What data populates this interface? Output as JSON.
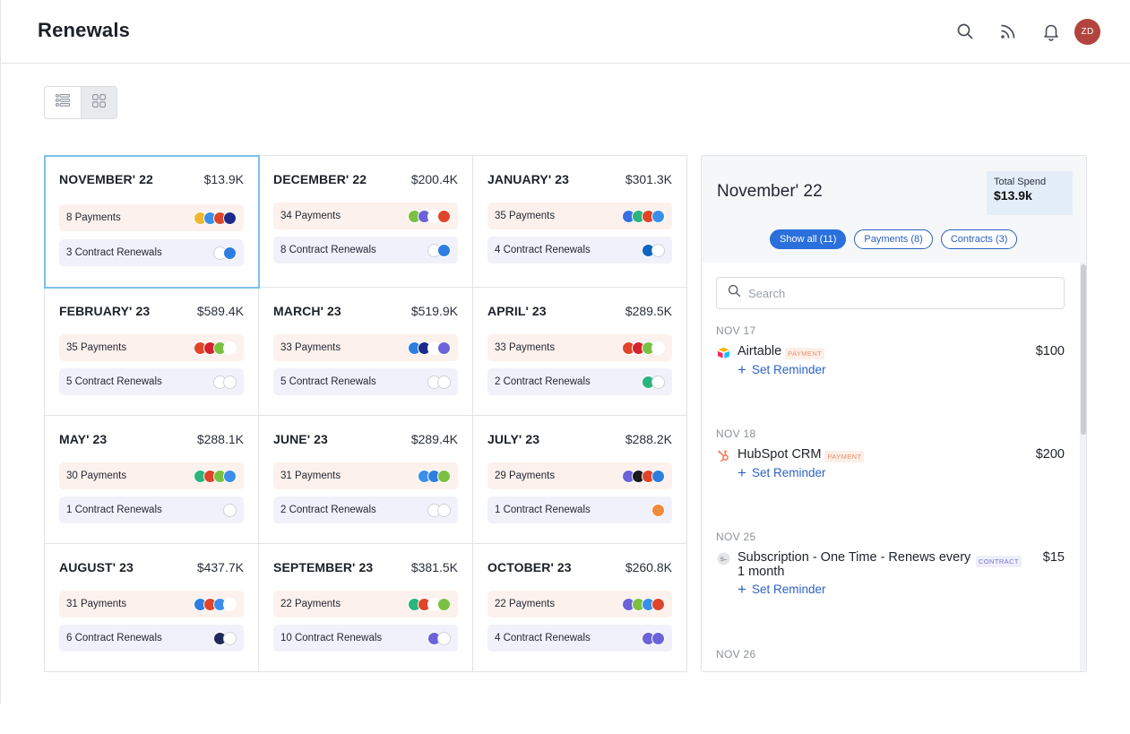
{
  "header": {
    "title": "Renewals",
    "avatar_initials": "ZD",
    "icons": [
      "search-icon",
      "rss-feed-icon",
      "bell-icon"
    ]
  },
  "view_toggle": {
    "options": [
      "list-view-icon",
      "grid-view-icon"
    ],
    "active": "grid"
  },
  "months": [
    {
      "month": "NOVEMBER' 22",
      "amount": "$13.9K",
      "payments": "8 Payments",
      "contracts": "3 Contract Renewals",
      "selected": true,
      "pay_logos": [
        "#f2b731",
        "#3b8fe8",
        "#e0452a",
        "#1e2a8a"
      ],
      "con_logos": [
        "ring",
        "#2f7de1"
      ]
    },
    {
      "month": "DECEMBER' 22",
      "amount": "$200.4K",
      "payments": "34 Payments",
      "contracts": "8 Contract Renewals",
      "pay_logos": [
        "#7ac142",
        "#6c63d8",
        "#ffffff",
        "#e0452a"
      ],
      "con_logos": [
        "ring",
        "#2f7de1"
      ]
    },
    {
      "month": "JANUARY' 23",
      "amount": "$301.3K",
      "payments": "35 Payments",
      "contracts": "4 Contract Renewals",
      "pay_logos": [
        "#3b6fe0",
        "#29b57c",
        "#e0452a",
        "#3b8fe8"
      ],
      "con_logos": [
        "#0a66c2",
        "ring"
      ]
    },
    {
      "month": "FEBRUARY' 23",
      "amount": "$589.4K",
      "payments": "35 Payments",
      "contracts": "5 Contract Renewals",
      "pay_logos": [
        "#e0452a",
        "#d4232f",
        "#7ac142",
        "#ffffff"
      ],
      "con_logos": [
        "ring",
        "ring"
      ]
    },
    {
      "month": "MARCH' 23",
      "amount": "$519.9K",
      "payments": "33 Payments",
      "contracts": "5 Contract Renewals",
      "pay_logos": [
        "#2f7de1",
        "#1e2a8a",
        "#ffffff",
        "#6c63d8"
      ],
      "con_logos": [
        "ring",
        "ring"
      ]
    },
    {
      "month": "APRIL' 23",
      "amount": "$289.5K",
      "payments": "33 Payments",
      "contracts": "2 Contract Renewals",
      "pay_logos": [
        "#e0452a",
        "#d4232f",
        "#7ac142",
        "#ffffff"
      ],
      "con_logos": [
        "#29b57c",
        "ring"
      ]
    },
    {
      "month": "MAY' 23",
      "amount": "$288.1K",
      "payments": "30 Payments",
      "contracts": "1 Contract Renewals",
      "pay_logos": [
        "#29b57c",
        "#e0452a",
        "#7ac142",
        "#3b8fe8"
      ],
      "con_logos": [
        "ring"
      ]
    },
    {
      "month": "JUNE' 23",
      "amount": "$289.4K",
      "payments": "31 Payments",
      "contracts": "2 Contract Renewals",
      "pay_logos": [
        "#3b8fe8",
        "#2f7de1",
        "#7ac142"
      ],
      "con_logos": [
        "ring",
        "ring"
      ]
    },
    {
      "month": "JULY' 23",
      "amount": "$288.2K",
      "payments": "29 Payments",
      "contracts": "1 Contract Renewals",
      "pay_logos": [
        "#6c63d8",
        "#1c1c1c",
        "#e0452a",
        "#2f7de1"
      ],
      "con_logos": [
        "#f08a3c"
      ]
    },
    {
      "month": "AUGUST' 23",
      "amount": "$437.7K",
      "payments": "31 Payments",
      "contracts": "6 Contract Renewals",
      "pay_logos": [
        "#2f7de1",
        "#e0452a",
        "#3b8fe8",
        "#ffffff"
      ],
      "con_logos": [
        "#1e2a5a",
        "ring"
      ]
    },
    {
      "month": "SEPTEMBER' 23",
      "amount": "$381.5K",
      "payments": "22 Payments",
      "contracts": "10 Contract Renewals",
      "pay_logos": [
        "#29b57c",
        "#e0452a",
        "#ffffff",
        "#7ac142"
      ],
      "con_logos": [
        "#6c63d8",
        "ring"
      ]
    },
    {
      "month": "OCTOBER' 23",
      "amount": "$260.8K",
      "payments": "22 Payments",
      "contracts": "4 Contract Renewals",
      "pay_logos": [
        "#6c63d8",
        "#7ac142",
        "#3b8fe8",
        "#e0452a"
      ],
      "con_logos": [
        "#6c63d8",
        "#6c63d8"
      ]
    }
  ],
  "panel": {
    "title": "November' 22",
    "spend_label": "Total Spend",
    "spend_value": "$13.9k",
    "filters": [
      "Show all (11)",
      "Payments (8)",
      "Contracts (3)"
    ],
    "active_filter": 0,
    "search_placeholder": "Search",
    "reminder_label": "Set Reminder",
    "entries": [
      {
        "date": "NOV 17",
        "name": "Airtable",
        "tag": "PAYMENT",
        "type": "payment",
        "price": "$100",
        "icon": "airtable-logo-icon"
      },
      {
        "date": "NOV 18",
        "name": "HubSpot CRM",
        "tag": "PAYMENT",
        "type": "payment",
        "price": "$200",
        "icon": "hubspot-logo-icon"
      },
      {
        "date": "NOV 25",
        "name": "Subscription - One Time - Renews every 1 month",
        "tag": "CONTRACT",
        "type": "contract",
        "price": "$15",
        "icon": "subscription-icon"
      },
      {
        "date": "NOV 26"
      }
    ]
  }
}
